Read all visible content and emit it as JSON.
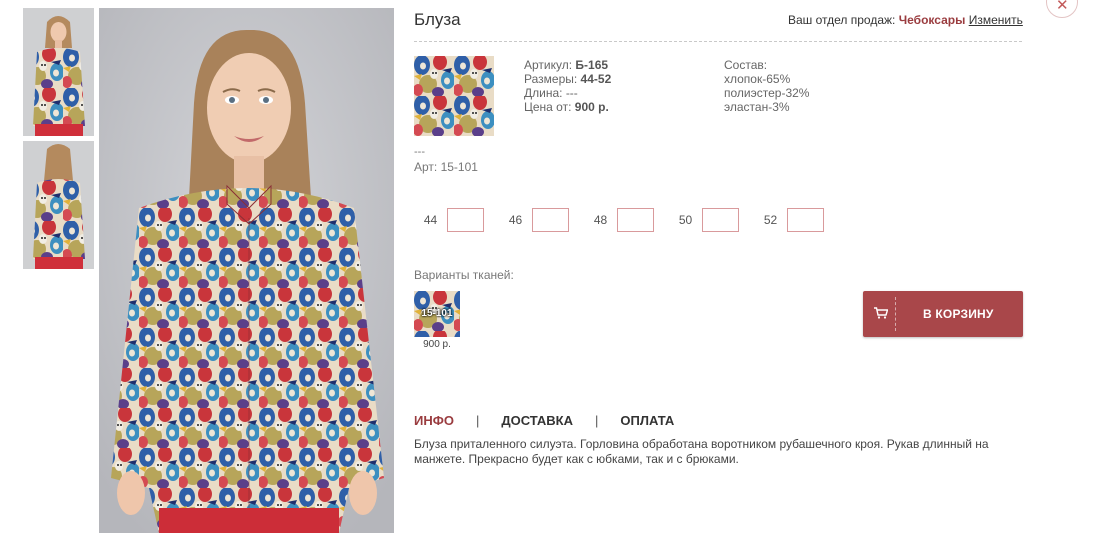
{
  "close": {
    "symbol": "✕"
  },
  "product": {
    "title": "Блуза",
    "specs": {
      "article_label": "Артикул:",
      "article_value": "Б-165",
      "sizes_label": "Размеры:",
      "sizes_value": "44-52",
      "length_label": "Длина:",
      "length_value": "---",
      "price_label": "Цена от:",
      "price_value": "900 р."
    },
    "composition": [
      "Состав:",
      "хлопок-65%",
      "полиэстер-32%",
      "эластан-3%"
    ],
    "dashes": "---",
    "art": "Арт: 15-101"
  },
  "dept": {
    "label": "Ваш отдел продаж:",
    "city": "Чебоксары",
    "change": "Изменить"
  },
  "sizes": [
    {
      "label": "44",
      "value": ""
    },
    {
      "label": "46",
      "value": ""
    },
    {
      "label": "48",
      "value": ""
    },
    {
      "label": "50",
      "value": ""
    },
    {
      "label": "52",
      "value": ""
    }
  ],
  "fabrics": {
    "heading": "Варианты тканей:",
    "items": [
      {
        "code": "15-101",
        "price": "900 р."
      }
    ]
  },
  "cart": {
    "label": "В КОРЗИНУ"
  },
  "tabs": [
    {
      "label": "ИНФО",
      "active": true
    },
    {
      "label": "ДОСТАВКА",
      "active": false
    },
    {
      "label": "ОПЛАТА",
      "active": false
    }
  ],
  "tab_separator": "|",
  "description": "Блуза приталенного силуэта. Горловина обработана воротником рубашечного кроя. Рукав длинный на манжете. Прекрасно будет как с юбками, так и с брюками.",
  "colors": {
    "accent": "#a9474a",
    "accent_text": "#9a3c3f",
    "input_border": "#d99a9c"
  }
}
